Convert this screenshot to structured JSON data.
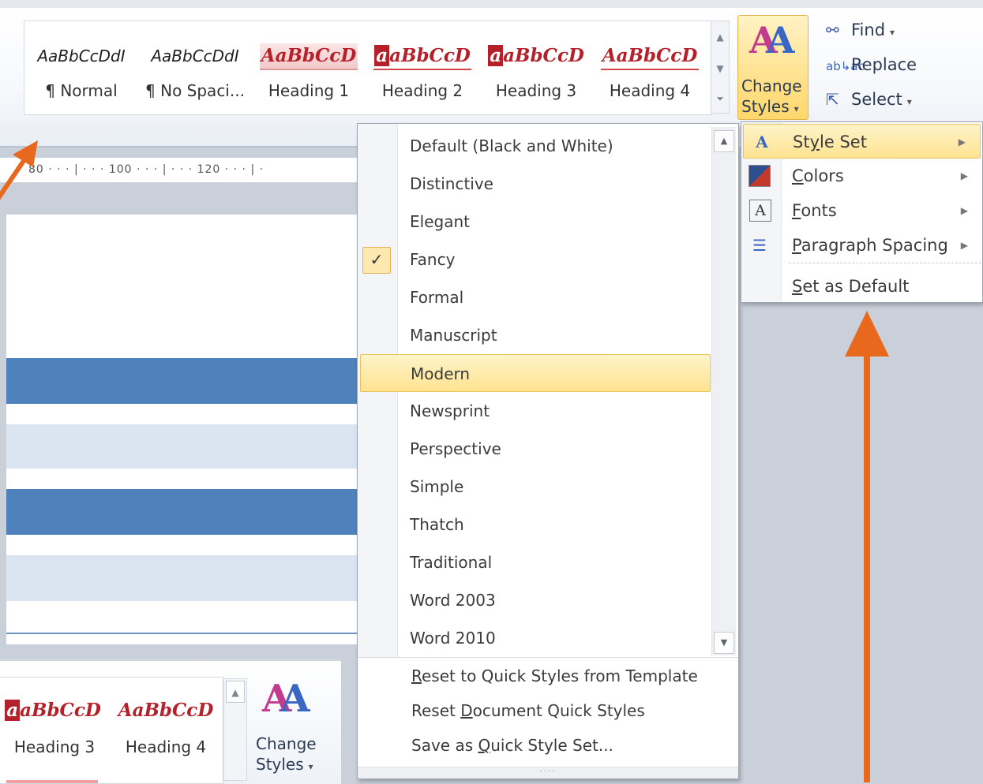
{
  "gallery": {
    "styles": [
      {
        "preview": "AaBbCcDdI",
        "label": "¶ Normal"
      },
      {
        "preview": "AaBbCcDdI",
        "label": "¶ No Spaci..."
      },
      {
        "preview": "AaBbCcD",
        "label": "Heading 1"
      },
      {
        "preview_cap": "a",
        "preview": "aBbCcD",
        "label": "Heading 2"
      },
      {
        "preview_cap": "a",
        "preview": "aBbCcD",
        "label": "Heading 3"
      },
      {
        "preview": "AaBbCcD",
        "label": "Heading 4"
      }
    ]
  },
  "change_styles": {
    "label_line1": "Change",
    "label_line2": "Styles",
    "icon": "change-styles-icon"
  },
  "editing": {
    "find": {
      "label": "Find",
      "icon": "binoculars-icon"
    },
    "replace": {
      "label": "Replace",
      "icon": "replace-icon"
    },
    "select": {
      "label": "Select",
      "icon": "cursor-arrow-icon"
    }
  },
  "ruler": {
    "text": "80 · · · | · · · 100 · · · | · · · 120 · · · | ·"
  },
  "style_set_menu": {
    "items": [
      {
        "label": "Default (Black and White)"
      },
      {
        "label": "Distinctive"
      },
      {
        "label": "Elegant"
      },
      {
        "label": "Fancy",
        "checked": true
      },
      {
        "label": "Formal"
      },
      {
        "label": "Manuscript"
      },
      {
        "label": "Modern",
        "highlighted": true
      },
      {
        "label": "Newsprint"
      },
      {
        "label": "Perspective"
      },
      {
        "label": "Simple"
      },
      {
        "label": "Thatch"
      },
      {
        "label": "Traditional"
      },
      {
        "label": "Word 2003"
      },
      {
        "label": "Word 2010"
      }
    ],
    "actions": [
      {
        "pre": "",
        "u": "R",
        "post": "eset to Quick Styles from Template"
      },
      {
        "pre": "Reset ",
        "u": "D",
        "post": "ocument Quick Styles"
      },
      {
        "pre": "Save as ",
        "u": "Q",
        "post": "uick Style Set..."
      }
    ],
    "check_mark": "✓"
  },
  "change_styles_menu": {
    "items": [
      {
        "pre": "St",
        "u": "y",
        "post": "le Set",
        "icon": "style-set-icon",
        "highlighted": true,
        "submenu": true
      },
      {
        "pre": "",
        "u": "C",
        "post": "olors",
        "icon": "colors-icon",
        "submenu": true
      },
      {
        "pre": "",
        "u": "F",
        "post": "onts",
        "icon": "fonts-icon",
        "submenu": true
      },
      {
        "pre": "",
        "u": "P",
        "post": "aragraph Spacing",
        "icon": "paragraph-spacing-icon",
        "submenu": true
      },
      {
        "pre": "",
        "u": "S",
        "post": "et as Default",
        "icon": "",
        "submenu": false
      }
    ]
  },
  "mini_ribbon": {
    "styles": [
      {
        "preview_cap": "a",
        "preview": "aBbCcD",
        "label": "Heading 3"
      },
      {
        "preview": "AaBbCcD",
        "label": "Heading 4"
      }
    ],
    "change_label_line1": "Change",
    "change_label_line2": "Styles"
  },
  "colors": {
    "accent_orange": "#e8681e",
    "highlight": "#ffe391",
    "band_dark": "#4f81bd",
    "band_light": "#dbe5f1",
    "heading_red": "#b4212a"
  }
}
